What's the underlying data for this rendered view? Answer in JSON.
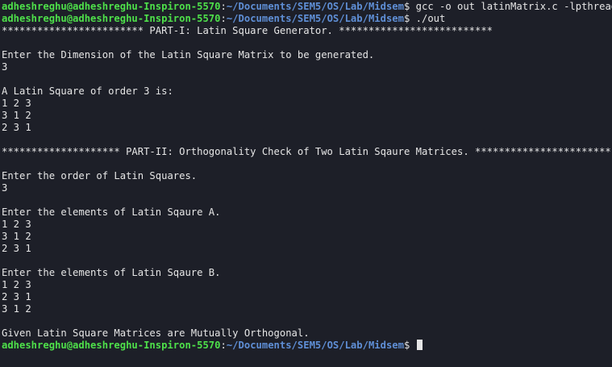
{
  "prompt": {
    "user_host": "adheshreghu@adheshreghu-Inspiron-5570",
    "colon": ":",
    "path": "~/Documents/SEM5/OS/Lab/Midsem",
    "symbol": "$"
  },
  "commands": [
    " gcc -o out latinMatrix.c -lpthread -lm",
    " ./out"
  ],
  "output": [
    "************************ PART-I: Latin Square Generator. **************************",
    "",
    "Enter the Dimension of the Latin Square Matrix to be generated.",
    "3",
    "",
    "A Latin Square of order 3 is:",
    "1 2 3",
    "3 1 2",
    "2 3 1",
    "",
    "******************** PART-II: Orthogonality Check of Two Latin Sqaure Matrices. ***********************",
    "",
    "Enter the order of Latin Squares.",
    "3",
    "",
    "Enter the elements of Latin Sqaure A.",
    "1 2 3",
    "3 1 2",
    "2 3 1",
    "",
    "Enter the elements of Latin Sqaure B.",
    "1 2 3",
    "2 3 1",
    "3 1 2",
    "",
    "Given Latin Square Matrices are Mutually Orthogonal."
  ],
  "colors": {
    "background": "#1d1f28",
    "user_host": "#4ee04a",
    "path": "#5f8fd6",
    "text": "#e6e6e6"
  }
}
